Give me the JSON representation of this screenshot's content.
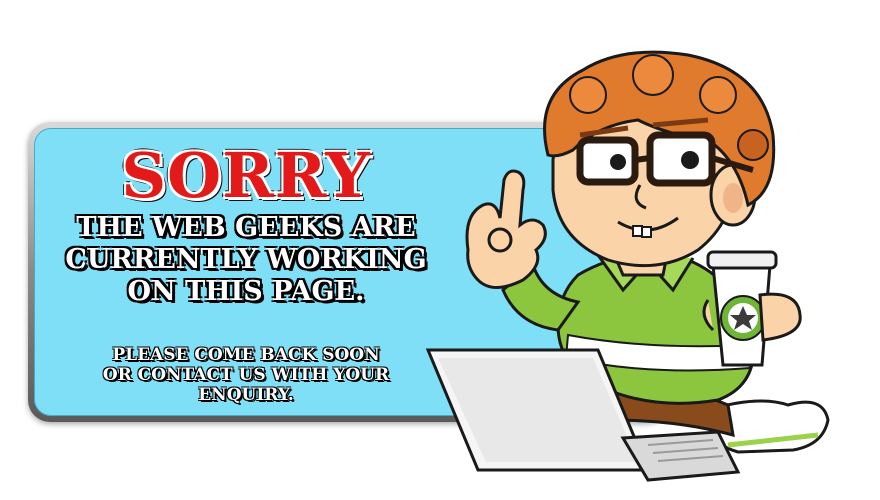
{
  "banner": {
    "title": "SORRY",
    "message_lines": [
      "THE WEB GEEKS ARE",
      "CURRENTLY WORKING",
      "ON THIS PAGE."
    ],
    "sub_lines": [
      "PLEASE COME BACK SOON",
      "OR CONTACT US WITH YOUR",
      "ENQUIRY."
    ]
  },
  "colors": {
    "title_red": "#e21a1a",
    "panel_blue": "#7fdff7",
    "hair_orange": "#e07a2c",
    "shirt_green": "#8cc63f"
  },
  "mascot": {
    "icon": "geek-mascot-icon"
  }
}
